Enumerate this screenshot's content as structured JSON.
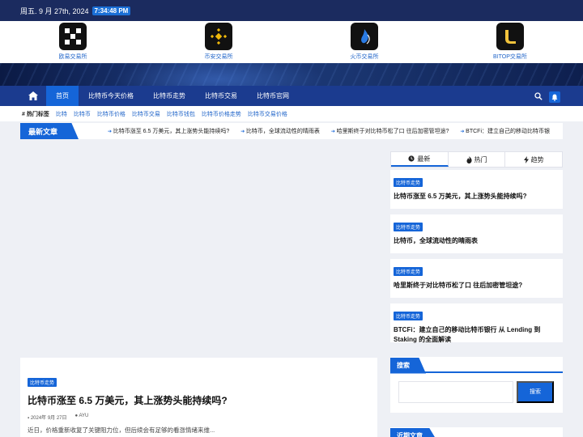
{
  "topbar": {
    "date": "周五. 9 月 27th, 2024",
    "time": "7:34:48 PM"
  },
  "exchanges": [
    {
      "label": "欧易交易所",
      "icon": "okx-logo-icon"
    },
    {
      "label": "币安交易所",
      "icon": "binance-logo-icon"
    },
    {
      "label": "火币交易所",
      "icon": "huobi-logo-icon"
    },
    {
      "label": "BITOP交易所",
      "icon": "bitop-logo-icon"
    }
  ],
  "nav": {
    "items": [
      "首页",
      "比特币今天价格",
      "比特币走势",
      "比特币交易",
      "比特币官网"
    ],
    "active_index": 0
  },
  "tags": {
    "title": "热门标签",
    "items": [
      "比特",
      "比特币",
      "比特币价格",
      "比特币交易",
      "比特币钱包",
      "比特币价格走势",
      "比特币交易价格"
    ]
  },
  "ticker": {
    "head": "最新文章",
    "items": [
      "比特币涨至 6.5 万美元，其上涨势头能持续吗?",
      "比特币，全球流动性的晴雨表",
      "哈里斯终于对比特币松了口 往后加密管坦途?",
      "BTCFi：建立自己的移动比特币银"
    ]
  },
  "article": {
    "category": "比特币走势",
    "title": "比特币涨至 6.5 万美元，其上涨势头能持续吗?",
    "date": "2024年 9月 27日",
    "author": "AYU",
    "excerpt": "近日，价格重新收复了关键阻力位，但后续会有足够的看涨情绪来维..."
  },
  "sidebar": {
    "tabs": [
      "最新",
      "热门",
      "趋势"
    ],
    "posts": [
      {
        "category": "比特币走势",
        "title": "比特币涨至 6.5 万美元，其上涨势头能持续吗?"
      },
      {
        "category": "比特币走势",
        "title": "比特币，全球流动性的晴雨表"
      },
      {
        "category": "比特币走势",
        "title": "哈里斯终于对比特币松了口 往后加密管坦途?"
      },
      {
        "category": "比特币走势",
        "title": "BTCFi：建立自己的移动比特币银行 从 Lending 到 Staking 的全面解读"
      }
    ],
    "search_title": "搜索",
    "search_button": "搜索",
    "recent_title": "近期文章"
  },
  "colors": {
    "accent": "#1565d8",
    "nav": "#1b3b8f",
    "topbar": "#1b2b5f"
  }
}
